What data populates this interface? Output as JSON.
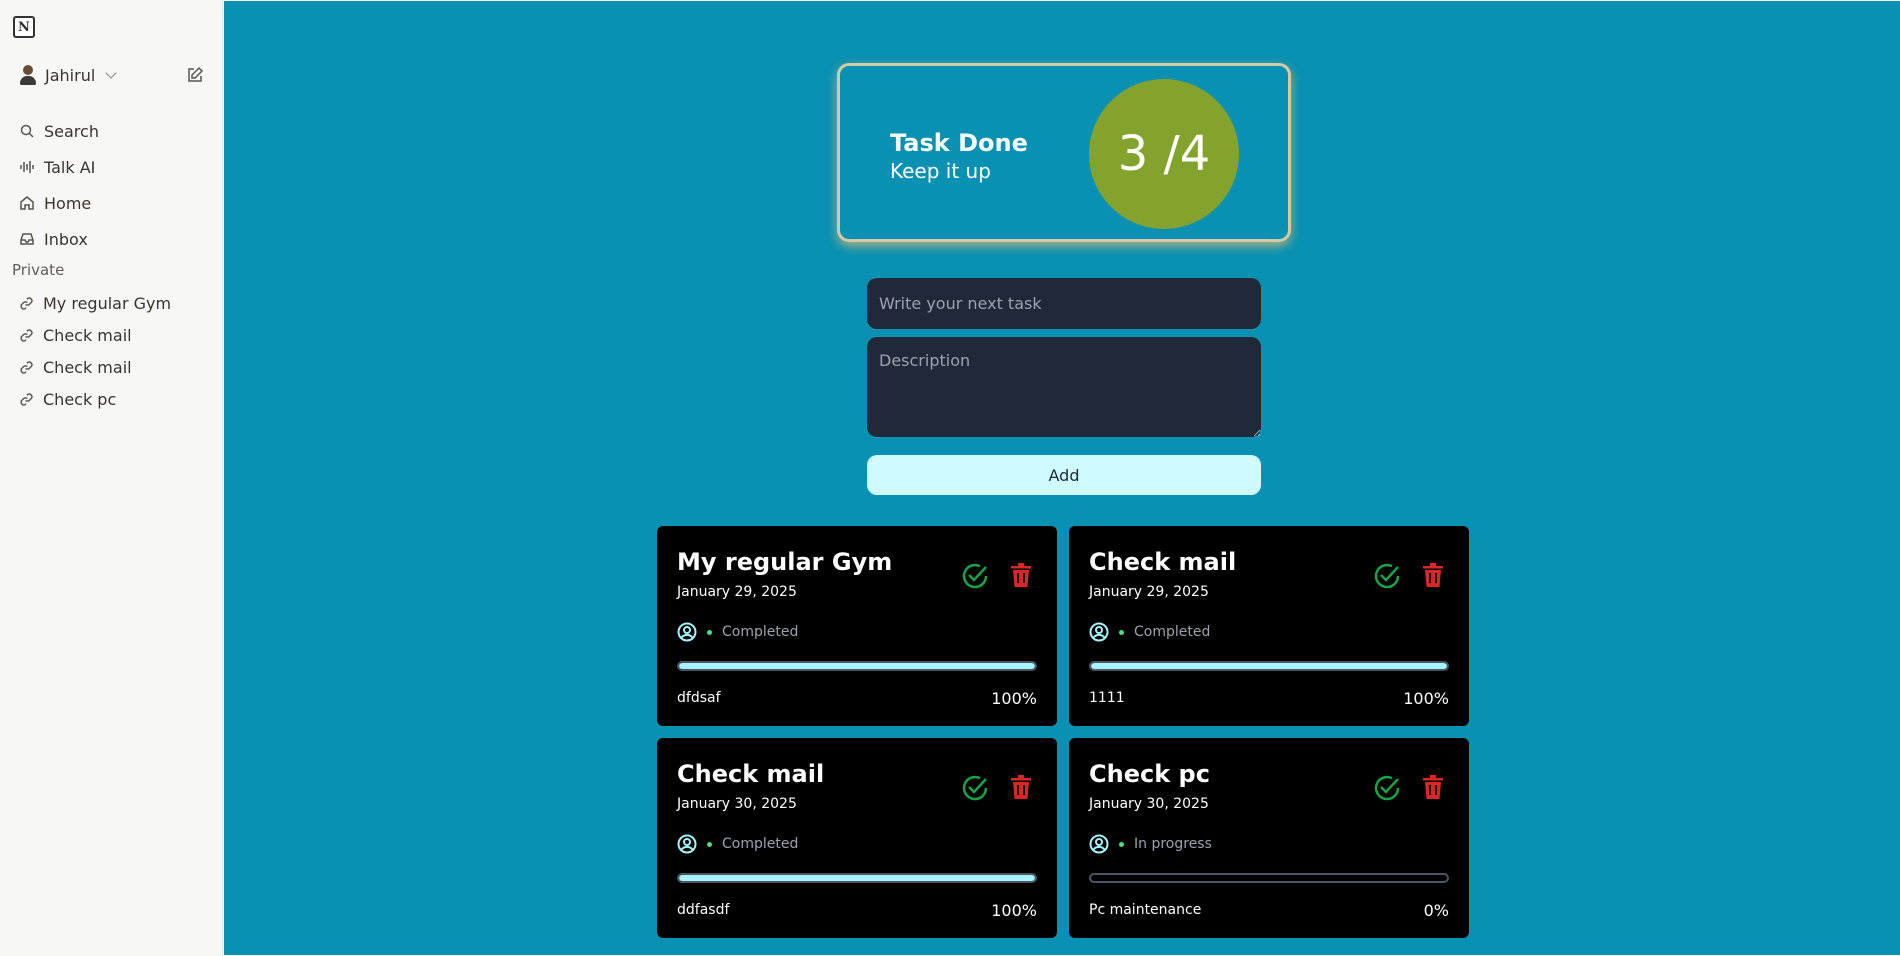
{
  "app": {
    "logo": "N"
  },
  "sidebar": {
    "workspace_name": "Jahirul",
    "nav": [
      {
        "label": "Search",
        "icon": "search-icon"
      },
      {
        "label": "Talk AI",
        "icon": "waveform-icon"
      },
      {
        "label": "Home",
        "icon": "home-icon"
      },
      {
        "label": "Inbox",
        "icon": "inbox-icon"
      }
    ],
    "section_label": "Private",
    "pages": [
      {
        "label": "My regular Gym",
        "icon": "link-icon"
      },
      {
        "label": "Check mail",
        "icon": "link-icon"
      },
      {
        "label": "Check mail",
        "icon": "link-icon"
      },
      {
        "label": "Check pc",
        "icon": "link-icon"
      }
    ]
  },
  "summary": {
    "title": "Task Done",
    "subtitle": "Keep it up",
    "counter": "3 /4"
  },
  "form": {
    "task_placeholder": "Write your next task",
    "description_placeholder": "Description",
    "add_label": "Add"
  },
  "tasks": [
    {
      "title": "My regular Gym",
      "date": "January 29, 2025",
      "status": "Completed",
      "description": "dfdsaf",
      "progress": 100,
      "progress_label": "100%"
    },
    {
      "title": "Check mail",
      "date": "January 29, 2025",
      "status": "Completed",
      "description": "1111",
      "progress": 100,
      "progress_label": "100%"
    },
    {
      "title": "Check mail",
      "date": "January 30, 2025",
      "status": "Completed",
      "description": "ddfasdf",
      "progress": 100,
      "progress_label": "100%"
    },
    {
      "title": "Check pc",
      "date": "January 30, 2025",
      "status": "In progress",
      "description": "Pc maintenance",
      "progress": 0,
      "progress_label": "0%"
    }
  ],
  "colors": {
    "main_bg": "#0891b2",
    "counter_bg": "#84a22e",
    "progress_fill": "#a5f3fc",
    "check": "#16a34a",
    "delete": "#dc2626"
  }
}
